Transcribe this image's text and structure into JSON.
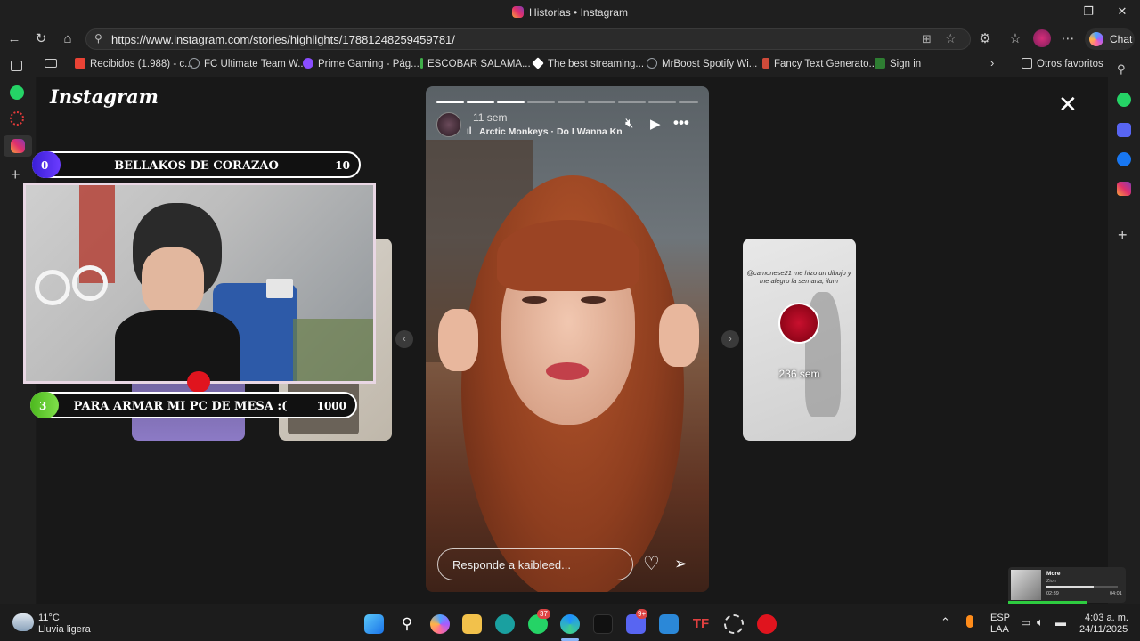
{
  "window": {
    "title": "Historias • Instagram"
  },
  "browser": {
    "url": "https://www.instagram.com/stories/highlights/17881248259459781/",
    "chat_label": "Chat",
    "bookmarks": [
      {
        "label": "Recibidos (1.988) - c...",
        "color": "#ea4335"
      },
      {
        "label": "FC Ultimate Team W...",
        "color": "#9aa0a6"
      },
      {
        "label": "Prime Gaming - Pág...",
        "color": "#8a4dff"
      },
      {
        "label": "ESCOBAR SALAMA...",
        "color": "#3fae49"
      },
      {
        "label": "The best streaming...",
        "color": "#ffffff"
      },
      {
        "label": "MrBoost Spotify Wi...",
        "color": "#9aa0a6"
      },
      {
        "label": "Fancy Text Generato...",
        "color": "#d04b3a"
      },
      {
        "label": "Sign in",
        "color": "#2e7d32"
      }
    ],
    "other_favorites": "Otros favoritos"
  },
  "instagram": {
    "logo": "Instagram",
    "story": {
      "time_ago": "11 sem",
      "music": "Arctic Monkeys · Do I Wanna Knov",
      "reply_placeholder": "Responde a kaibleed..."
    },
    "next_card": {
      "time_ago": "236 sem",
      "caption": "@camonese21 me hizo un dibujo y me alegro la semana, ilum"
    }
  },
  "overlay": {
    "goal_top": {
      "count": "0",
      "label": "BELLAKOS DE CORAZAO",
      "target": "10"
    },
    "goal_bottom": {
      "count": "3",
      "label": "PARA ARMAR MI PC DE MESA :(",
      "target": "1000"
    }
  },
  "taskbar": {
    "weather_temp": "11°C",
    "weather_desc": "Lluvia ligera",
    "lang": "ESP",
    "lang_sub": "LAA",
    "time": "4:03 a. m.",
    "date": "24/11/2025",
    "whatsapp_badge": "37",
    "discord_badge": "9+",
    "media_title": "More",
    "media_artist": "Zion",
    "media_elapsed": "02:39",
    "media_total": "04:01"
  }
}
